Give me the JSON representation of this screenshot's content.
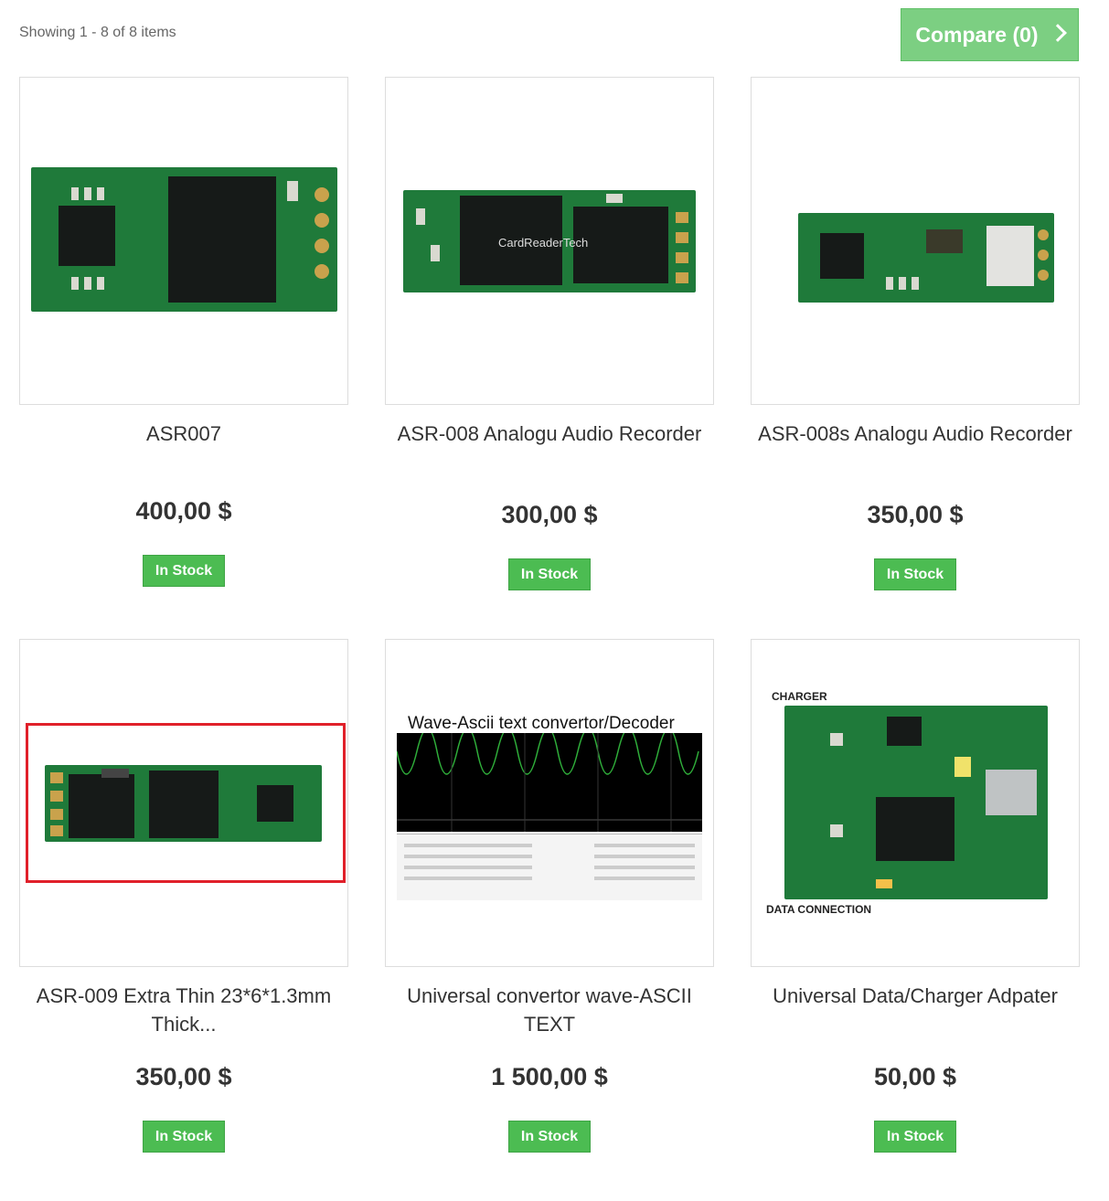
{
  "toolbar": {
    "showing": "Showing 1 - 8 of 8 items",
    "compare_label": "Compare (0)"
  },
  "products": [
    {
      "name": "ASR007",
      "price": "400,00 $",
      "stock": "In Stock"
    },
    {
      "name": "ASR-008 Analogu Audio Recorder",
      "price": "300,00 $",
      "stock": "In Stock",
      "chip_text": "CardReaderTech"
    },
    {
      "name": "ASR-008s Analogu Audio Recorder",
      "price": "350,00 $",
      "stock": "In Stock"
    },
    {
      "name": "ASR-009 Extra Thin 23*6*1.3mm Thick...",
      "price": "350,00 $",
      "stock": "In Stock"
    },
    {
      "name": "Universal convertor wave-ASCII TEXT",
      "price": "1 500,00 $",
      "stock": "In Stock",
      "image_title": "Wave-Ascii text convertor/Decoder"
    },
    {
      "name": "Universal Data/Charger Adpater",
      "price": "50,00 $",
      "stock": "In Stock",
      "label_top": "CHARGER",
      "label_bottom": "DATA CONNECTION"
    }
  ],
  "colors": {
    "compare_bg": "#7ccf82",
    "stock_bg": "#4cbc52",
    "highlight": "#e0202a",
    "pcb": "#1f7a3a"
  },
  "icons": {
    "compare_arrow": "chevron-right-icon"
  }
}
